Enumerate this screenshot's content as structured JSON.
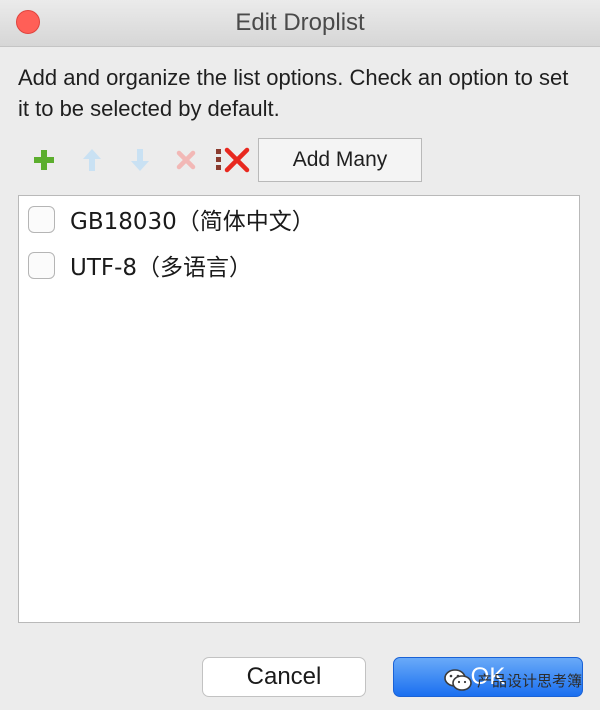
{
  "window": {
    "title": "Edit Droplist"
  },
  "description": "Add and organize the list options. Check an option to set it to be selected by default.",
  "toolbar": {
    "icons": [
      "plus-icon",
      "arrow-up-icon",
      "arrow-down-icon",
      "remove-icon",
      "remove-all-icon"
    ],
    "add_many_label": "Add Many"
  },
  "list": {
    "items": [
      {
        "label": "GB18030（简体中文）",
        "checked": false
      },
      {
        "label": "UTF-8（多语言）",
        "checked": false
      }
    ]
  },
  "buttons": {
    "cancel_label": "Cancel",
    "ok_label": "OK"
  },
  "watermark": {
    "text": "产品设计思考簿"
  },
  "colors": {
    "accent": "#1a6ff0",
    "close": "#ff5f57",
    "add_green": "#5cae2e",
    "delete_red": "#e8281f"
  }
}
